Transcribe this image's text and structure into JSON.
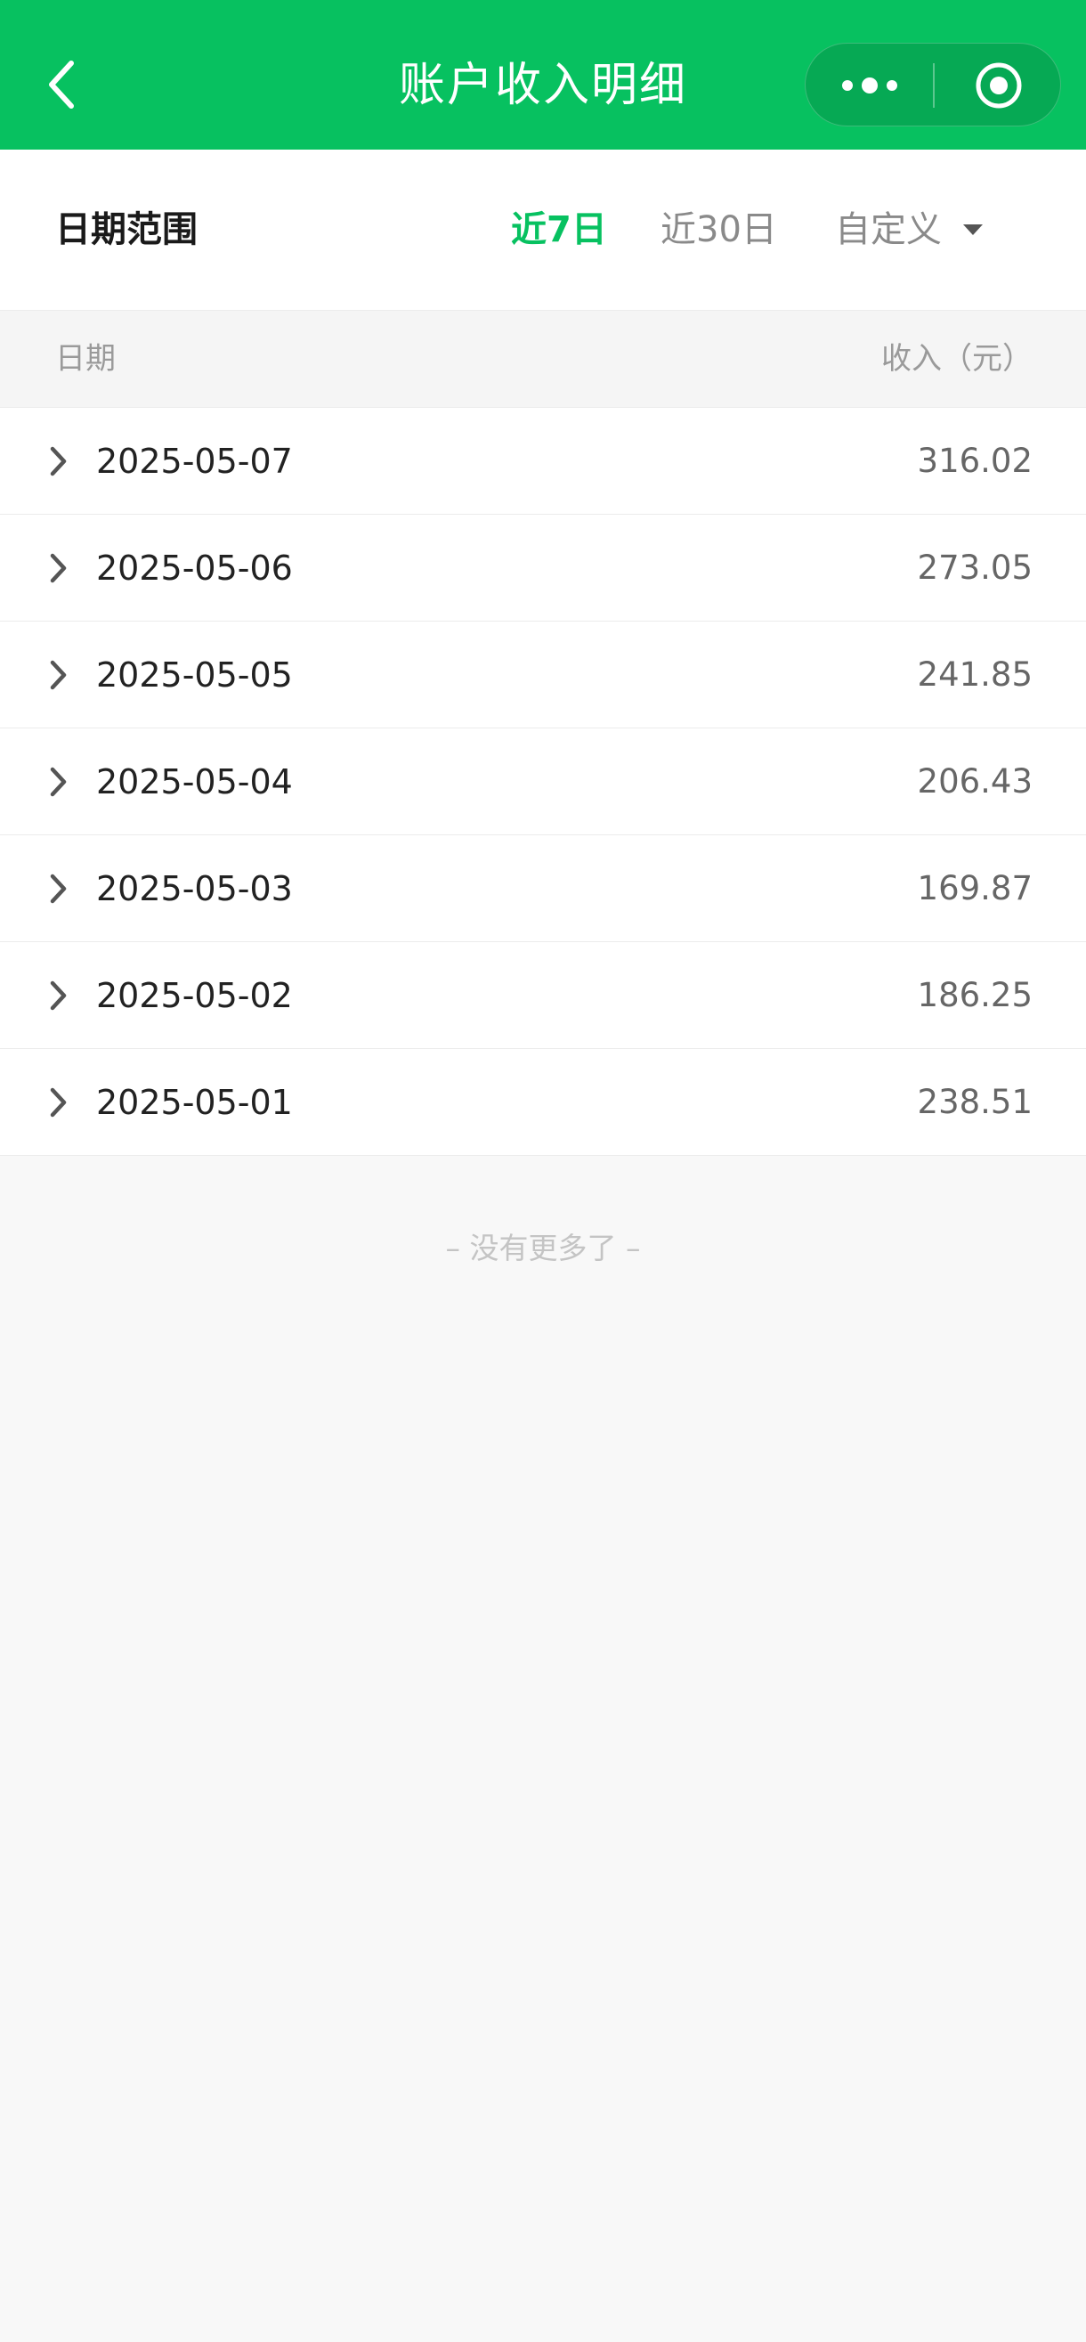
{
  "header": {
    "title": "账户收入明细",
    "background_color": "#07c160",
    "back_icon": "chevron-left-icon",
    "more_icon": "more-dots-icon",
    "close_icon": "target-circle-icon"
  },
  "filter": {
    "label": "日期范围",
    "options": [
      {
        "label": "近7日",
        "selected": true
      },
      {
        "label": "近30日",
        "selected": false
      },
      {
        "label": "自定义",
        "selected": false,
        "icon": "caret-down-icon"
      }
    ],
    "accent_color": "#07c160"
  },
  "table": {
    "columns": [
      "日期",
      "收入（元）"
    ],
    "rows": [
      {
        "date": "2025-05-07",
        "amount": "316.02"
      },
      {
        "date": "2025-05-06",
        "amount": "273.05"
      },
      {
        "date": "2025-05-05",
        "amount": "241.85"
      },
      {
        "date": "2025-05-04",
        "amount": "206.43"
      },
      {
        "date": "2025-05-03",
        "amount": "169.87"
      },
      {
        "date": "2025-05-02",
        "amount": "186.25"
      },
      {
        "date": "2025-05-01",
        "amount": "238.51"
      }
    ],
    "row_icon": "chevron-right-icon"
  },
  "footer": {
    "end_text": "–  没有更多了  –"
  }
}
